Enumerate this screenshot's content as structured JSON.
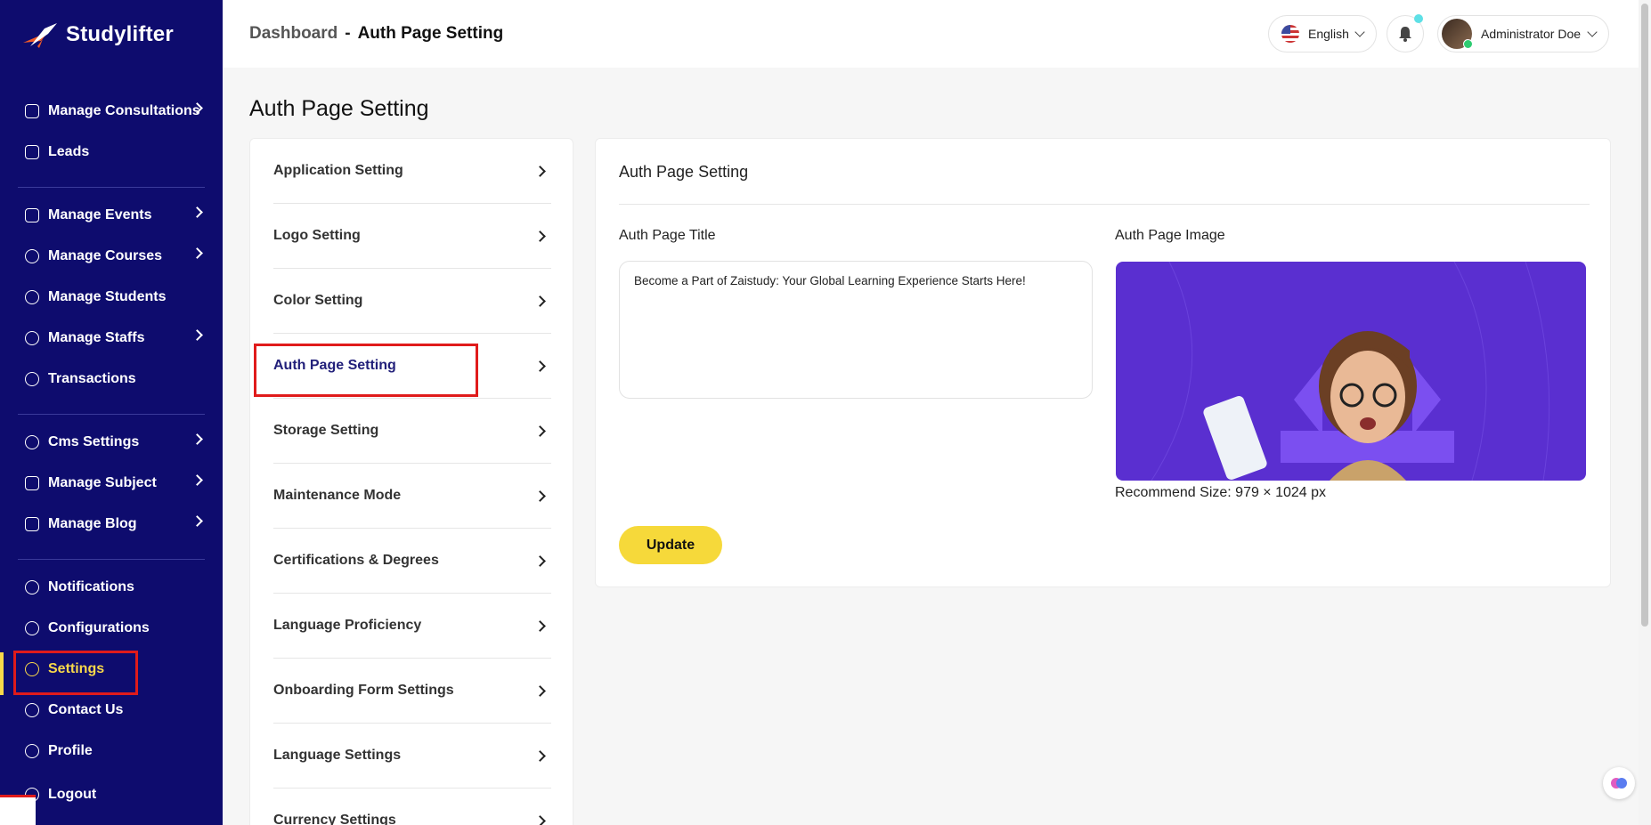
{
  "brand": {
    "name": "Studylifter"
  },
  "sidebar": {
    "items": [
      {
        "label": "Manage Consultations",
        "icon": "consultation-icon",
        "has_children": true
      },
      {
        "label": "Leads",
        "icon": "leads-icon",
        "has_children": false
      },
      {
        "label": "Manage Events",
        "icon": "calendar-icon",
        "has_children": true
      },
      {
        "label": "Manage Courses",
        "icon": "courses-icon",
        "has_children": true
      },
      {
        "label": "Manage Students",
        "icon": "students-icon",
        "has_children": false
      },
      {
        "label": "Manage Staffs",
        "icon": "staffs-icon",
        "has_children": true
      },
      {
        "label": "Transactions",
        "icon": "transactions-icon",
        "has_children": false
      },
      {
        "label": "Cms Settings",
        "icon": "cms-icon",
        "has_children": true
      },
      {
        "label": "Manage Subject",
        "icon": "subject-icon",
        "has_children": true
      },
      {
        "label": "Manage Blog",
        "icon": "blog-icon",
        "has_children": true
      },
      {
        "label": "Notifications",
        "icon": "bell-icon",
        "has_children": false
      },
      {
        "label": "Configurations",
        "icon": "configurations-icon",
        "has_children": false
      },
      {
        "label": "Settings",
        "icon": "gear-icon",
        "has_children": false,
        "active": true
      },
      {
        "label": "Contact Us",
        "icon": "contact-icon",
        "has_children": false
      },
      {
        "label": "Profile",
        "icon": "user-icon",
        "has_children": false
      },
      {
        "label": "Logout",
        "icon": "logout-icon",
        "has_children": false
      }
    ]
  },
  "header": {
    "breadcrumb": {
      "root": "Dashboard",
      "separator": "-",
      "current": "Auth Page Setting"
    },
    "language": "English",
    "user_name": "Administrator Doe"
  },
  "main": {
    "page_title": "Auth Page Setting",
    "settings_menu": [
      {
        "label": "Application Setting"
      },
      {
        "label": "Logo Setting"
      },
      {
        "label": "Color Setting"
      },
      {
        "label": "Auth Page Setting",
        "active": true
      },
      {
        "label": "Storage Setting"
      },
      {
        "label": "Maintenance Mode"
      },
      {
        "label": "Certifications & Degrees"
      },
      {
        "label": "Language Proficiency"
      },
      {
        "label": "Onboarding Form Settings"
      },
      {
        "label": "Language Settings"
      },
      {
        "label": "Currency Settings"
      }
    ],
    "form": {
      "title": "Auth Page Setting",
      "title_label": "Auth Page Title",
      "title_value": "Become a Part of Zaistudy: Your Global Learning Experience Starts Here!",
      "image_label": "Auth Page Image",
      "recommend_size": "Recommend Size: 979 × 1024 px",
      "update_label": "Update"
    }
  },
  "colors": {
    "sidebar_bg": "#0e0c6e",
    "accent_yellow": "#f6d93a",
    "highlight_red": "#e01b1b",
    "image_bg": "#5a2fd0"
  }
}
